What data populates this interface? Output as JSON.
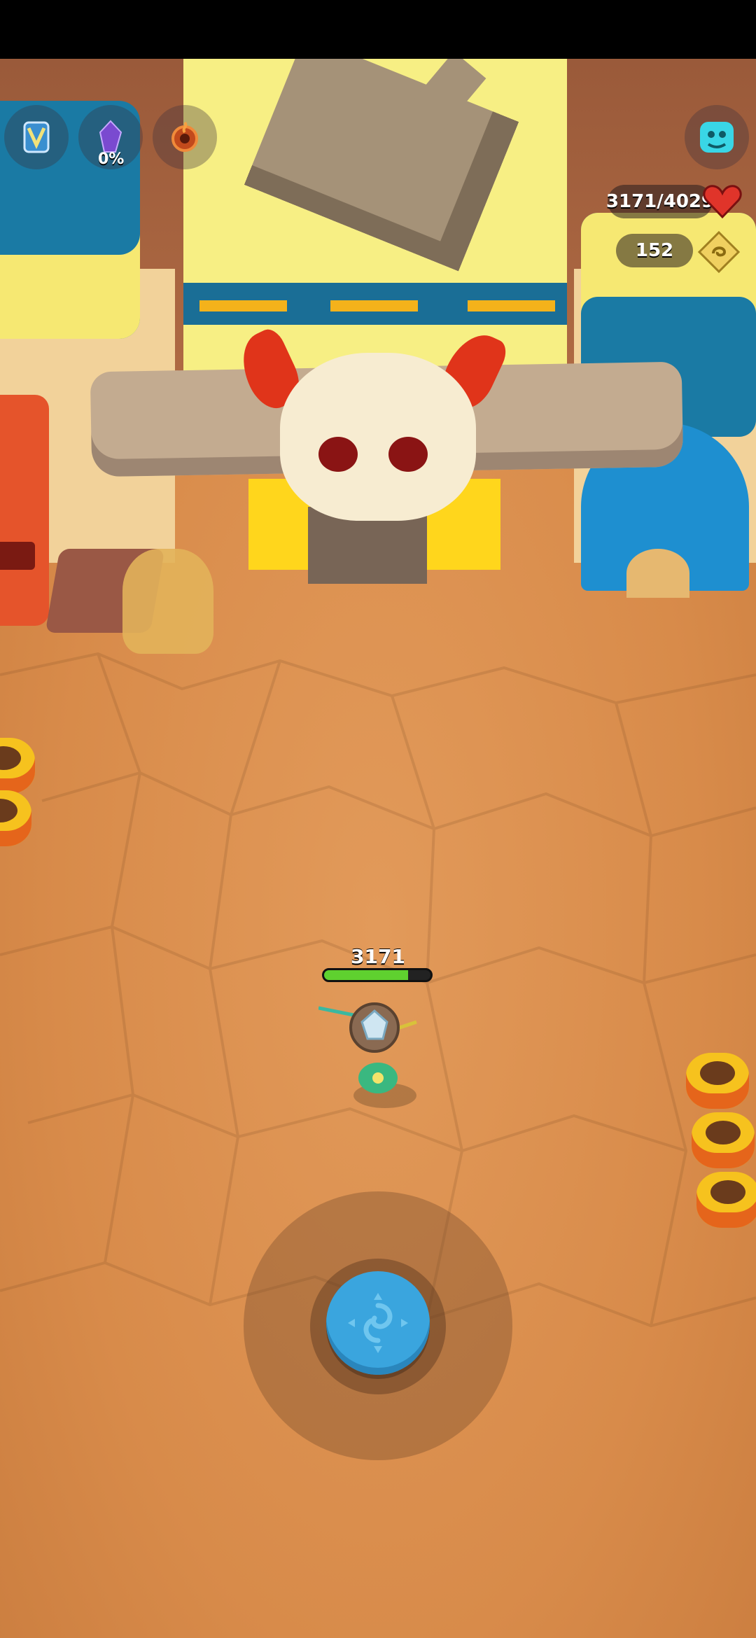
{
  "hud": {
    "ability_1": {
      "icon": "map-banner-icon"
    },
    "ability_2": {
      "icon": "purple-crystal-icon",
      "label": "0%"
    },
    "ability_3": {
      "icon": "fire-ring-icon"
    },
    "menu": {
      "icon": "cyan-creature-icon"
    },
    "health": {
      "text": "3171/4029",
      "icon": "heart-icon"
    },
    "currency": {
      "text": "152",
      "icon": "coin-icon"
    }
  },
  "player": {
    "hp_text": "3171",
    "hp_fraction": 0.79
  },
  "joystick": {
    "icon": "joystick-swirl-icon"
  },
  "colors": {
    "ground": "#d98e4e",
    "accent_blue": "#3aa5de",
    "hp_green": "#5fd12f",
    "heart_red": "#e0342a"
  }
}
